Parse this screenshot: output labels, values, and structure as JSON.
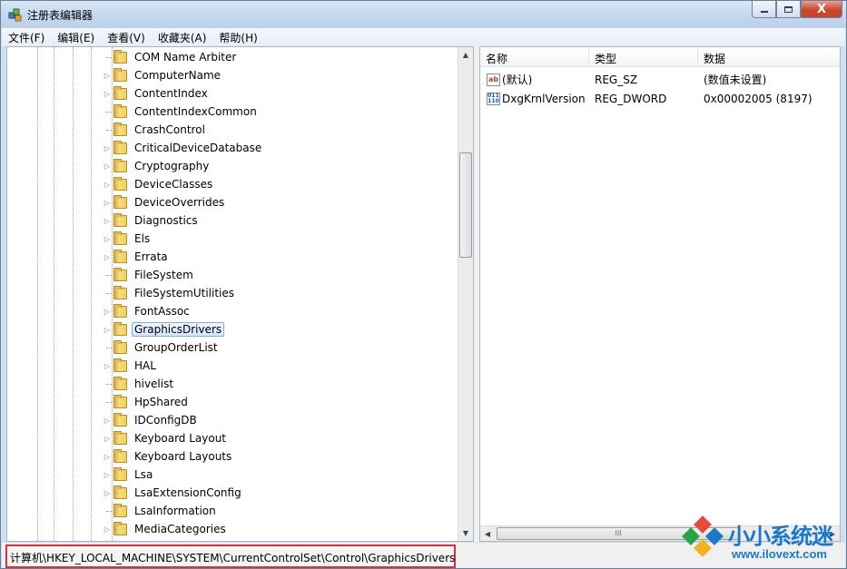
{
  "window": {
    "title": "注册表编辑器",
    "buttons": {
      "minimize": "▭",
      "maximize": "□",
      "close": "X"
    }
  },
  "menu": [
    "文件(F)",
    "编辑(E)",
    "查看(V)",
    "收藏夹(A)",
    "帮助(H)"
  ],
  "tree": {
    "items": [
      {
        "label": "COM Name Arbiter",
        "expandable": false
      },
      {
        "label": "ComputerName",
        "expandable": true
      },
      {
        "label": "ContentIndex",
        "expandable": true
      },
      {
        "label": "ContentIndexCommon",
        "expandable": false
      },
      {
        "label": "CrashControl",
        "expandable": false
      },
      {
        "label": "CriticalDeviceDatabase",
        "expandable": true
      },
      {
        "label": "Cryptography",
        "expandable": true
      },
      {
        "label": "DeviceClasses",
        "expandable": true
      },
      {
        "label": "DeviceOverrides",
        "expandable": true
      },
      {
        "label": "Diagnostics",
        "expandable": true
      },
      {
        "label": "Els",
        "expandable": true
      },
      {
        "label": "Errata",
        "expandable": true
      },
      {
        "label": "FileSystem",
        "expandable": false
      },
      {
        "label": "FileSystemUtilities",
        "expandable": false
      },
      {
        "label": "FontAssoc",
        "expandable": true
      },
      {
        "label": "GraphicsDrivers",
        "expandable": true,
        "selected": true
      },
      {
        "label": "GroupOrderList",
        "expandable": false
      },
      {
        "label": "HAL",
        "expandable": true
      },
      {
        "label": "hivelist",
        "expandable": false
      },
      {
        "label": "HpShared",
        "expandable": false
      },
      {
        "label": "IDConfigDB",
        "expandable": true
      },
      {
        "label": "Keyboard Layout",
        "expandable": true
      },
      {
        "label": "Keyboard Layouts",
        "expandable": true
      },
      {
        "label": "Lsa",
        "expandable": true
      },
      {
        "label": "LsaExtensionConfig",
        "expandable": true
      },
      {
        "label": "LsaInformation",
        "expandable": false
      },
      {
        "label": "MediaCategories",
        "expandable": true
      }
    ]
  },
  "list": {
    "columns": {
      "name": "名称",
      "type": "类型",
      "data": "数据"
    },
    "rows": [
      {
        "icon": "string-value-icon",
        "name": "(默认)",
        "type": "REG_SZ",
        "data": "(数值未设置)"
      },
      {
        "icon": "binary-value-icon",
        "name": "DxgKrnlVersion",
        "type": "REG_DWORD",
        "data": "0x00002005 (8197)"
      }
    ]
  },
  "status": {
    "path": "计算机\\HKEY_LOCAL_MACHINE\\SYSTEM\\CurrentControlSet\\Control\\GraphicsDrivers"
  },
  "watermark": {
    "name": "小小系统迷",
    "url": "www.ilovext.com"
  },
  "colors": {
    "highlight_border": "#d9303a",
    "watermark_blue": "#1a78c9"
  }
}
